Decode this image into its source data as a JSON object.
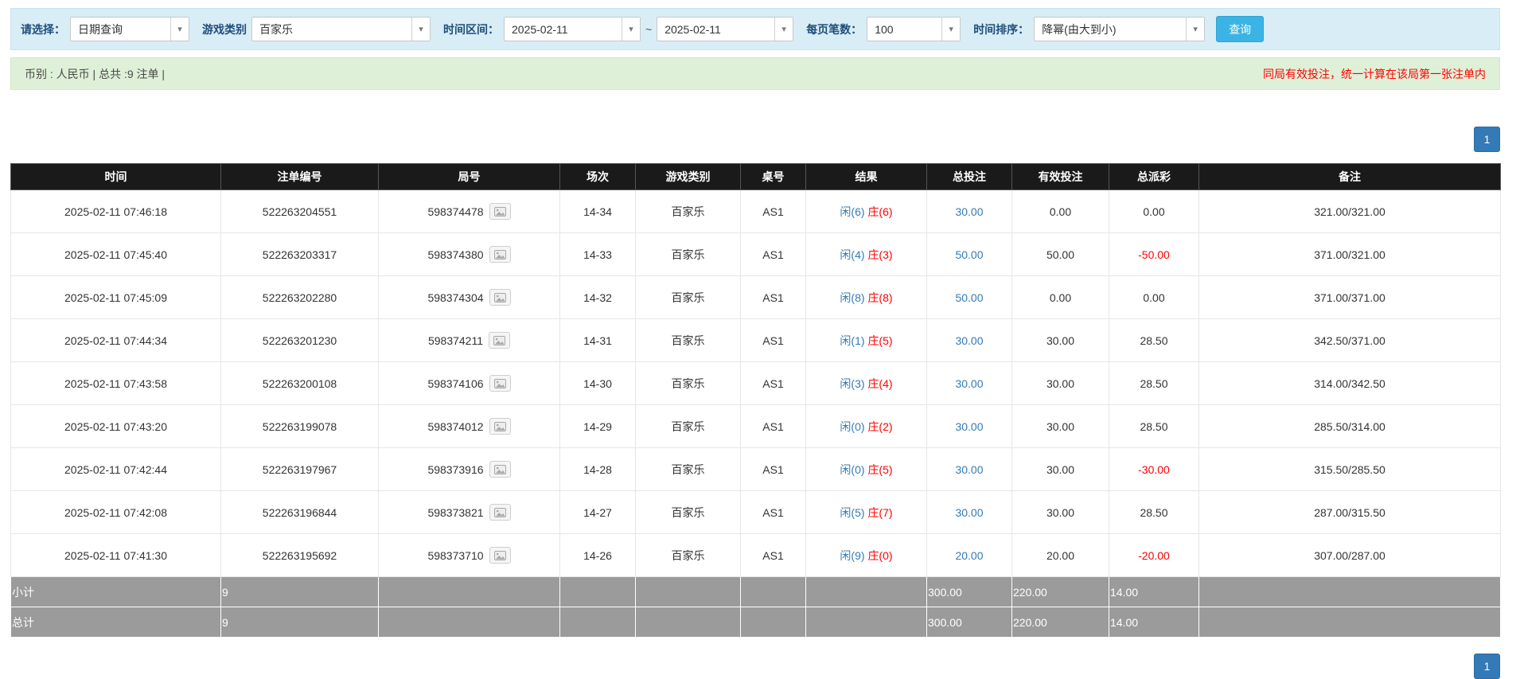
{
  "filters": {
    "select_label": "请选择：",
    "select_value": "日期查询",
    "game_label": "游戏类别",
    "game_value": "百家乐",
    "range_label": "时间区间：",
    "date_from": "2025-02-11",
    "separator": "~",
    "date_to": "2025-02-11",
    "per_page_label": "每页笔数：",
    "per_page_value": "100",
    "sort_label": "时间排序：",
    "sort_value": "降幂(由大到小)",
    "query_button": "查询",
    "caret_glyph": "▾"
  },
  "info_bar": {
    "summary_text": "币别 : 人民币 | 总共 :9 注单 |",
    "notice_text": "同局有效投注，统一计算在该局第一张注单内"
  },
  "pagination": {
    "current_page": "1"
  },
  "table": {
    "headers": [
      "时间",
      "注单编号",
      "局号",
      "场次",
      "游戏类别",
      "桌号",
      "结果",
      "总投注",
      "有效投注",
      "总派彩",
      "备注"
    ],
    "rows": [
      {
        "time": "2025-02-11 07:46:18",
        "bet_no": "522263204551",
        "round": "598374478",
        "session": "14-34",
        "game": "百家乐",
        "table_no": "AS1",
        "result_player": "闲(6)",
        "result_banker": "庄(6)",
        "total_bet": "30.00",
        "valid_bet": "0.00",
        "payout": "0.00",
        "remark": "321.00/321.00"
      },
      {
        "time": "2025-02-11 07:45:40",
        "bet_no": "522263203317",
        "round": "598374380",
        "session": "14-33",
        "game": "百家乐",
        "table_no": "AS1",
        "result_player": "闲(4)",
        "result_banker": "庄(3)",
        "total_bet": "50.00",
        "valid_bet": "50.00",
        "payout": "-50.00",
        "remark": "371.00/321.00"
      },
      {
        "time": "2025-02-11 07:45:09",
        "bet_no": "522263202280",
        "round": "598374304",
        "session": "14-32",
        "game": "百家乐",
        "table_no": "AS1",
        "result_player": "闲(8)",
        "result_banker": "庄(8)",
        "total_bet": "50.00",
        "valid_bet": "0.00",
        "payout": "0.00",
        "remark": "371.00/371.00"
      },
      {
        "time": "2025-02-11 07:44:34",
        "bet_no": "522263201230",
        "round": "598374211",
        "session": "14-31",
        "game": "百家乐",
        "table_no": "AS1",
        "result_player": "闲(1)",
        "result_banker": "庄(5)",
        "total_bet": "30.00",
        "valid_bet": "30.00",
        "payout": "28.50",
        "remark": "342.50/371.00"
      },
      {
        "time": "2025-02-11 07:43:58",
        "bet_no": "522263200108",
        "round": "598374106",
        "session": "14-30",
        "game": "百家乐",
        "table_no": "AS1",
        "result_player": "闲(3)",
        "result_banker": "庄(4)",
        "total_bet": "30.00",
        "valid_bet": "30.00",
        "payout": "28.50",
        "remark": "314.00/342.50"
      },
      {
        "time": "2025-02-11 07:43:20",
        "bet_no": "522263199078",
        "round": "598374012",
        "session": "14-29",
        "game": "百家乐",
        "table_no": "AS1",
        "result_player": "闲(0)",
        "result_banker": "庄(2)",
        "total_bet": "30.00",
        "valid_bet": "30.00",
        "payout": "28.50",
        "remark": "285.50/314.00"
      },
      {
        "time": "2025-02-11 07:42:44",
        "bet_no": "522263197967",
        "round": "598373916",
        "session": "14-28",
        "game": "百家乐",
        "table_no": "AS1",
        "result_player": "闲(0)",
        "result_banker": "庄(5)",
        "total_bet": "30.00",
        "valid_bet": "30.00",
        "payout": "-30.00",
        "remark": "315.50/285.50"
      },
      {
        "time": "2025-02-11 07:42:08",
        "bet_no": "522263196844",
        "round": "598373821",
        "session": "14-27",
        "game": "百家乐",
        "table_no": "AS1",
        "result_player": "闲(5)",
        "result_banker": "庄(7)",
        "total_bet": "30.00",
        "valid_bet": "30.00",
        "payout": "28.50",
        "remark": "287.00/315.50"
      },
      {
        "time": "2025-02-11 07:41:30",
        "bet_no": "522263195692",
        "round": "598373710",
        "session": "14-26",
        "game": "百家乐",
        "table_no": "AS1",
        "result_player": "闲(9)",
        "result_banker": "庄(0)",
        "total_bet": "20.00",
        "valid_bet": "20.00",
        "payout": "-20.00",
        "remark": "307.00/287.00"
      }
    ],
    "subtotal": {
      "label": "小计",
      "count": "9",
      "total_bet": "300.00",
      "valid_bet": "220.00",
      "payout": "14.00"
    },
    "total": {
      "label": "总计",
      "count": "9",
      "total_bet": "300.00",
      "valid_bet": "220.00",
      "payout": "14.00"
    }
  },
  "colors": {
    "filter_bg": "#d9edf7",
    "info_bg": "#dff0d8",
    "header_bg": "#1a1a1a",
    "summary_bg": "#9b9b9b",
    "link_blue": "#337ab7",
    "player_blue": "#337ab7",
    "banker_red": "#ff0000",
    "negative_red": "#ff0000",
    "query_button_cyan": "#3bb4e5",
    "page_button_blue": "#337ab7"
  }
}
